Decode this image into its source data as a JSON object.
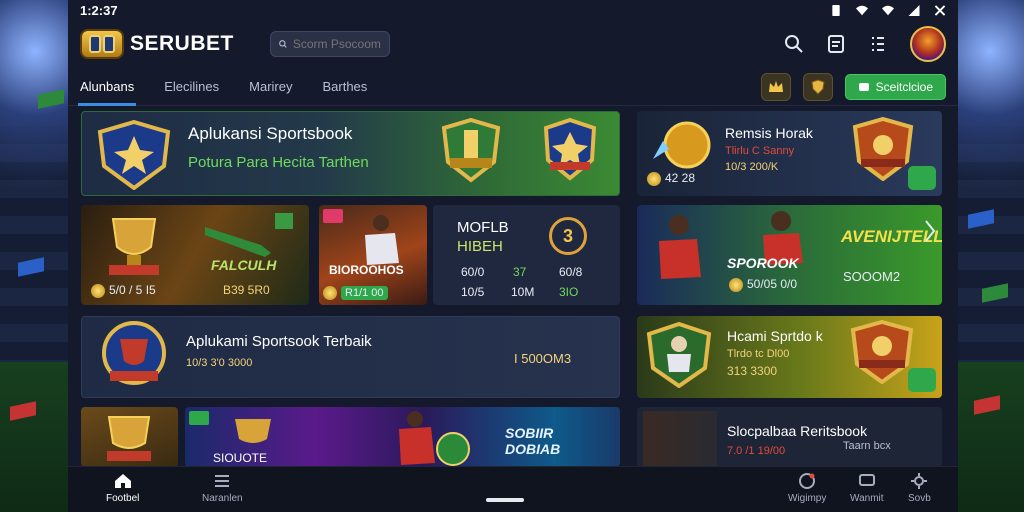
{
  "status": {
    "time": "1:2:37"
  },
  "header": {
    "brand": "SERUBET",
    "search_placeholder": "Scorm Psocoom"
  },
  "tabs": [
    {
      "label": "Alunbans"
    },
    {
      "label": "Elecilines"
    },
    {
      "label": "Marirey"
    },
    {
      "label": "Barthes"
    }
  ],
  "cta_label": "Sceitclcioe",
  "colors": {
    "accent_green": "#2ea84a",
    "tab_indicator": "#3a8de0",
    "gold": "#f3c64a",
    "background": "#141a2b"
  },
  "cards": {
    "hero": {
      "title": "Aplukansi Sportsbook",
      "subtitle": "Potura Para Hecita Tarthen"
    },
    "promo_right": {
      "title": "Remsis Horak",
      "line1": "Tlirlu C Sanny",
      "line2": "10/3 200/K",
      "stat": "42 28"
    },
    "trophy_card": {
      "title": "FALCULH",
      "score1": "5/0 / 5 I5",
      "score2": "B39 5R0"
    },
    "player_card": {
      "title": "BIOROOHOS",
      "score": "R1/1 00"
    },
    "match_table": {
      "heading1": "MOFLB",
      "heading2": "HIBEH",
      "number": "3",
      "rows": [
        [
          "60/0",
          "37",
          "60/8"
        ],
        [
          "10/5",
          "10M",
          "3IO"
        ]
      ]
    },
    "football_card": {
      "title": "SPOROOK",
      "headline": "AVENIJTELL",
      "stat": "50/05 0/0",
      "amount": "SOOOM2"
    },
    "sportsbook_best": {
      "title": "Aplukami Sportsook Terbaik",
      "sub": "10/3 3'0 3000",
      "amount": "I 500OM3"
    },
    "right_card_2": {
      "title": "Hcami Sprtdo k",
      "line1": "Tlrdo tc Dl00",
      "line2": "313 3300"
    },
    "bottom_banner": {
      "left_label": "SIOUOTE",
      "right_text": "SOBIIR DOBIAB"
    },
    "bottom_right": {
      "title": "Slocpalbaa Reritsbook",
      "line1": "Taarn bcx",
      "line2": "7.0 /1 19/00"
    }
  },
  "bottom_nav": [
    {
      "label": "Footbel"
    },
    {
      "label": "Naranlen"
    },
    {
      "label": "Wigimpy"
    },
    {
      "label": "Wanmit"
    },
    {
      "label": "Sovb"
    }
  ]
}
